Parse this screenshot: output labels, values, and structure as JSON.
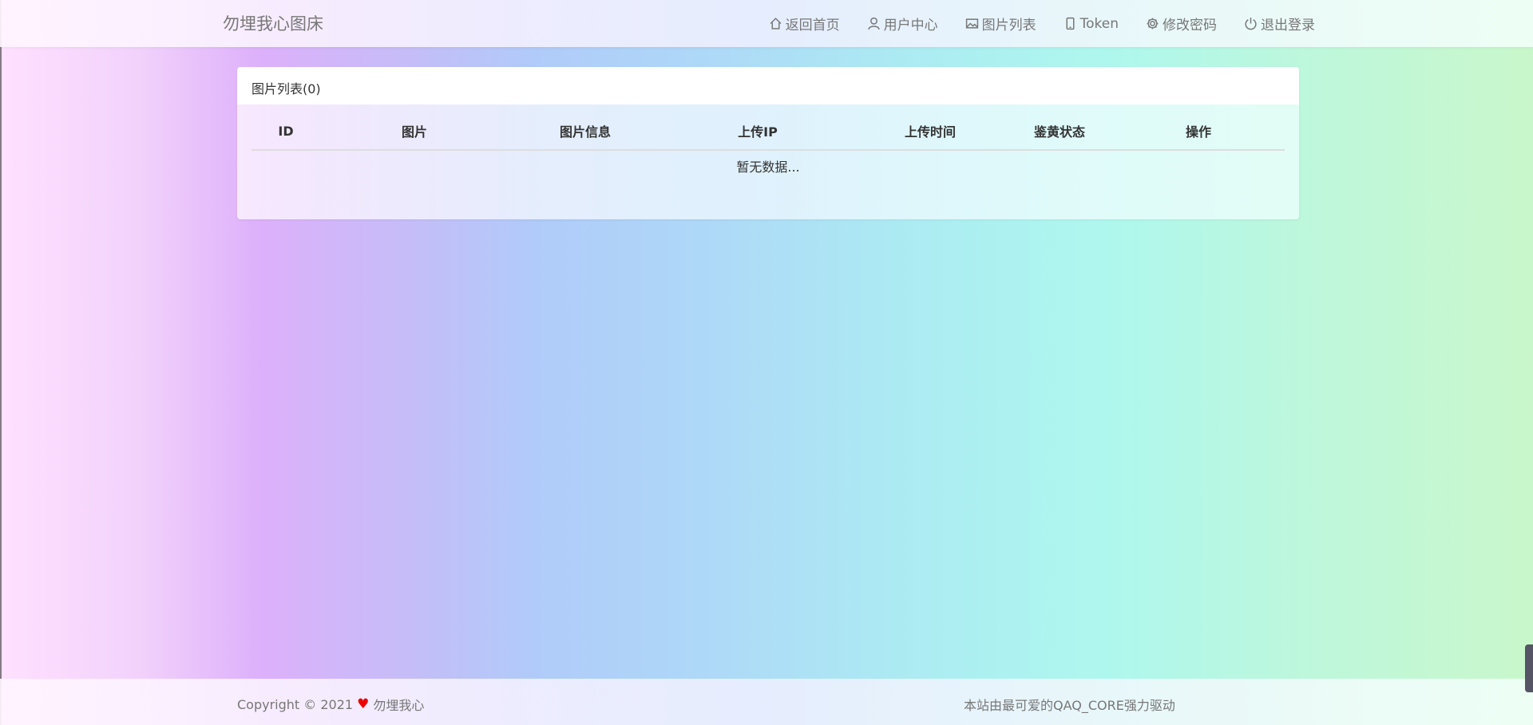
{
  "navbar": {
    "brand": "勿埋我心图床",
    "items": [
      {
        "label": "返回首页",
        "icon": "home-icon"
      },
      {
        "label": "用户中心",
        "icon": "user-icon"
      },
      {
        "label": "图片列表",
        "icon": "image-icon"
      },
      {
        "label": "Token",
        "icon": "phone-icon"
      },
      {
        "label": "修改密码",
        "icon": "gear-icon"
      },
      {
        "label": "退出登录",
        "icon": "power-icon"
      }
    ]
  },
  "panel": {
    "title": "图片列表(0)",
    "columns": [
      "ID",
      "图片",
      "图片信息",
      "上传IP",
      "上传时间",
      "鉴黄状态",
      "操作"
    ],
    "empty_text": "暂无数据..."
  },
  "footer": {
    "copyright": "Copyright © 2021",
    "owner": "勿埋我心",
    "powered_by": "本站由最可爱的QAQ_CORE强力驱动"
  }
}
